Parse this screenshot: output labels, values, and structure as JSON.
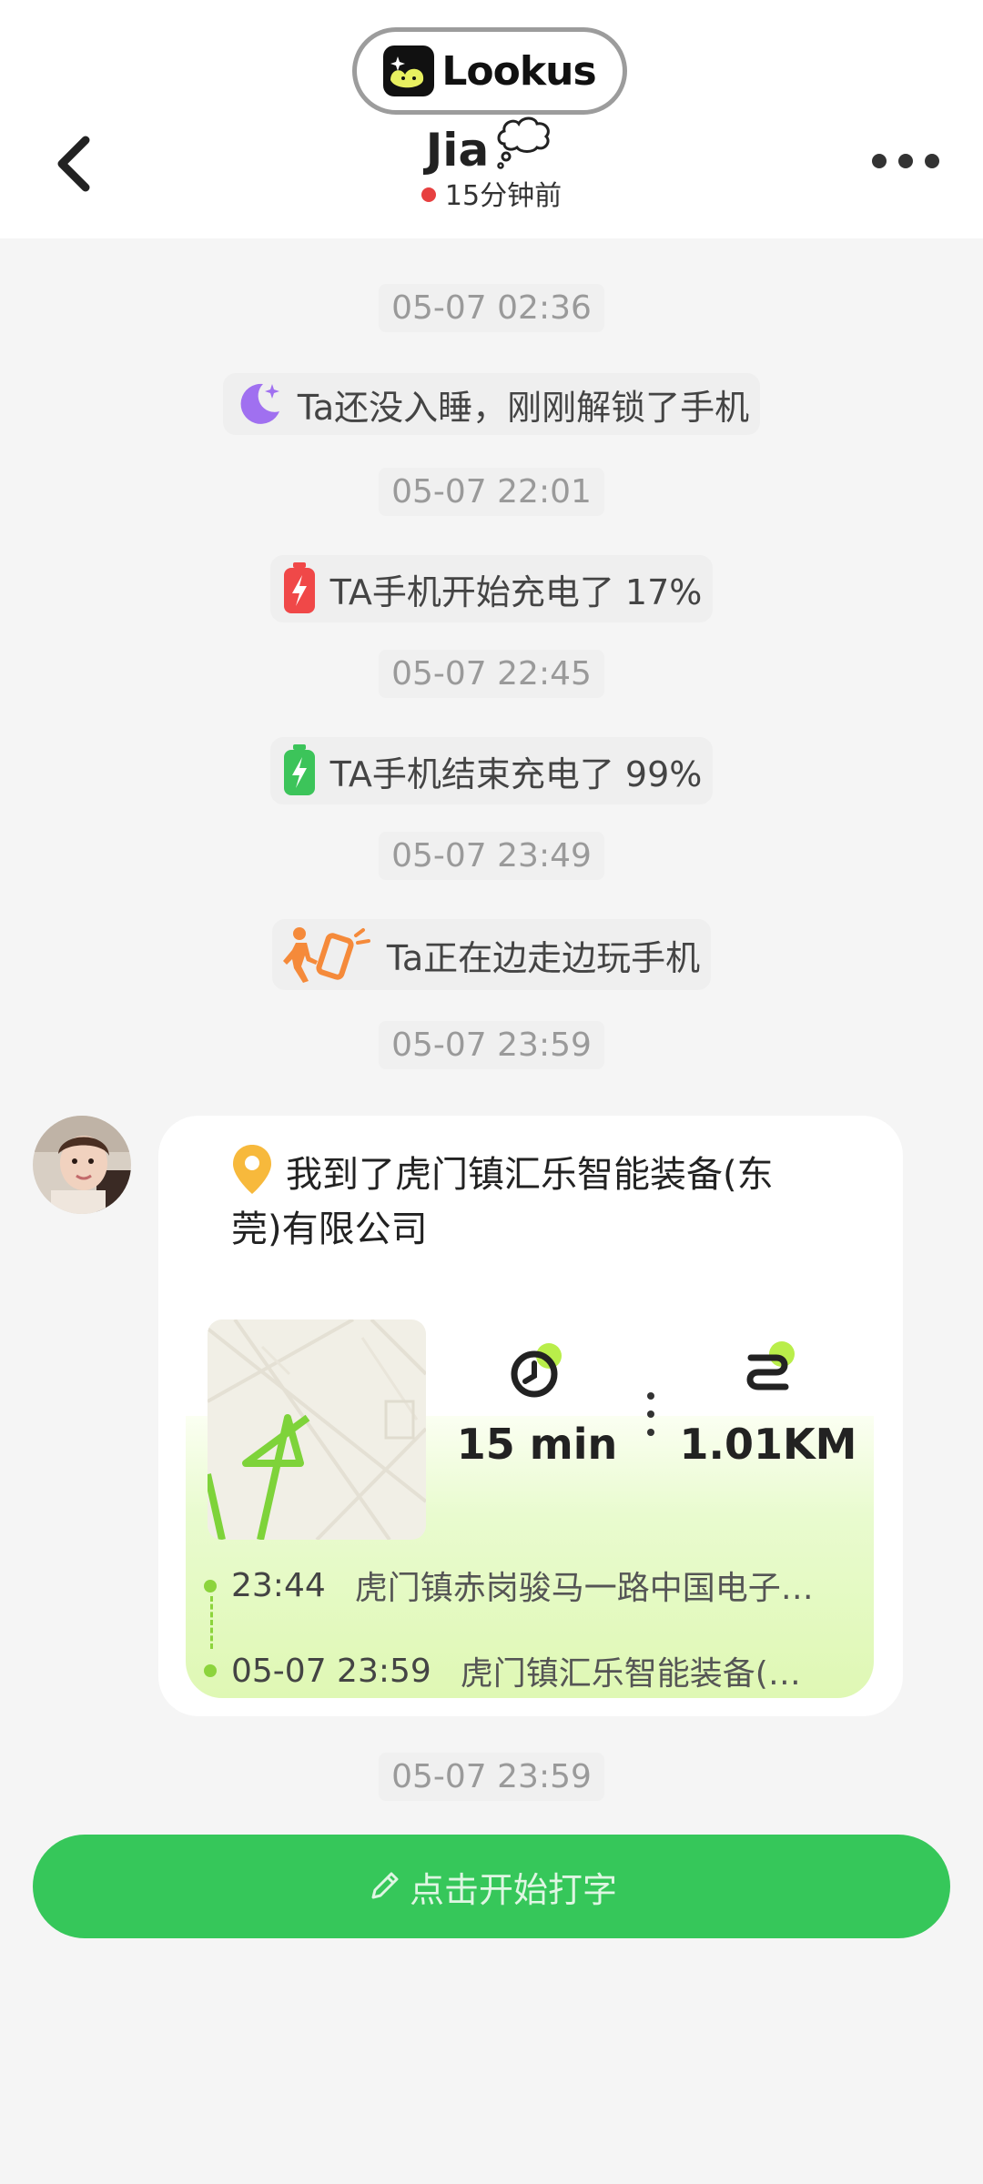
{
  "app": {
    "brand_name": "Lookus"
  },
  "header": {
    "contact_name": "Jia",
    "status_text": "15分钟前",
    "status_color": "#e74040"
  },
  "timeline": [
    {
      "timestamp": "05-07 02:36",
      "event": "Ta还没入睡，刚刚解锁了手机",
      "icon": "moon-icon",
      "icon_color": "#a070f0"
    },
    {
      "timestamp": "05-07 22:01",
      "event": "TA手机开始充电了 17%",
      "icon": "battery-charging-icon",
      "icon_color": "#f04848"
    },
    {
      "timestamp": "05-07 22:45",
      "event": "TA手机结束充电了 99%",
      "icon": "battery-charging-icon",
      "icon_color": "#3cc45a"
    },
    {
      "timestamp": "05-07 23:49",
      "event": "Ta正在边走边玩手机",
      "icon": "walking-phone-icon",
      "icon_color": "#f58a3a"
    }
  ],
  "location_card": {
    "timestamp": "05-07 23:59",
    "title": "我到了虎门镇汇乐智能装备(东莞)有限公司",
    "duration": "15 min",
    "distance": "1.01KM",
    "route": [
      {
        "time": "23:44",
        "address": "虎门镇赤岗骏马一路中国电子…"
      },
      {
        "time": "05-07 23:59",
        "address": "虎门镇汇乐智能装备(…"
      }
    ]
  },
  "footer_timestamp": "05-07 23:59",
  "input": {
    "placeholder": "点击开始打字"
  },
  "colors": {
    "accent_green": "#36c75a",
    "route_green": "#8cd43c"
  }
}
